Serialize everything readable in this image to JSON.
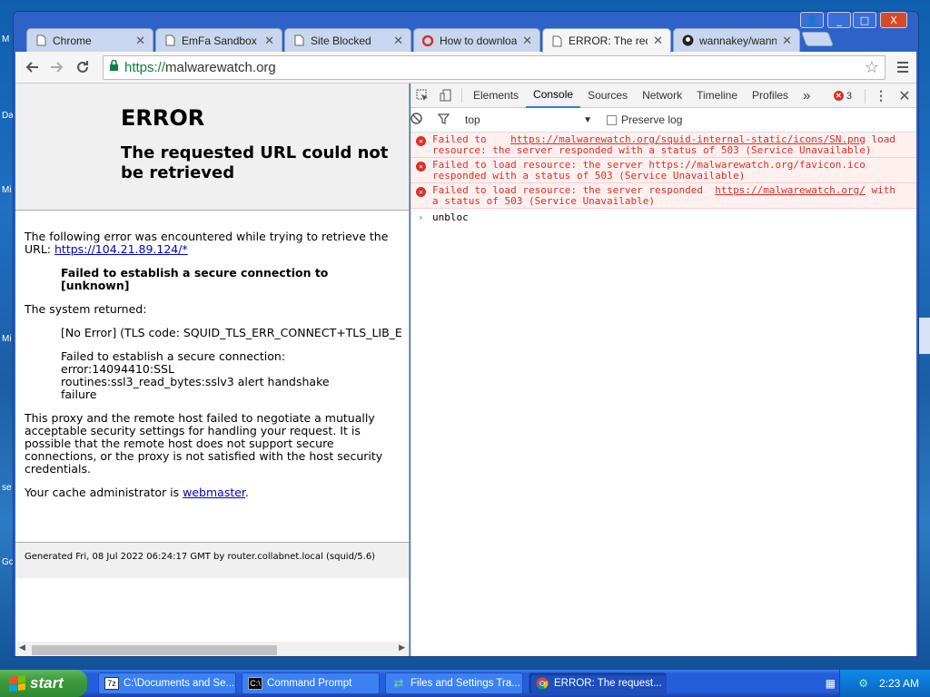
{
  "desktop": {
    "edge_labels": [
      "M",
      "Da",
      "Mi",
      "Mi",
      "se",
      "Gc"
    ]
  },
  "window": {
    "controls": {
      "help": "?",
      "minimize": "_",
      "maximize": "□",
      "close": "X"
    }
  },
  "tabs": [
    {
      "label": "Chrome",
      "icon": "page-icon",
      "active": false
    },
    {
      "label": "EmFa Sandbox",
      "icon": "page-icon",
      "active": false
    },
    {
      "label": "Site Blocked",
      "icon": "page-icon",
      "active": false
    },
    {
      "label": "How to download",
      "icon": "opera-icon",
      "active": false
    },
    {
      "label": "ERROR: The reque",
      "icon": "page-icon",
      "active": true
    },
    {
      "label": "wannakey/wanna",
      "icon": "github-icon",
      "active": false
    }
  ],
  "omnibox": {
    "scheme": "https://",
    "host": "malwarewatch.org"
  },
  "error_page": {
    "title": "ERROR",
    "subtitle": "The requested URL could not be retrieved",
    "intro": "The following error was encountered while trying to retrieve the URL:",
    "url": "https://104.21.89.124/*",
    "failure_line1": "Failed to establish a secure connection to",
    "failure_line2": "[unknown]",
    "system_returned": "The system returned:",
    "tls_code": "[No Error] (TLS code: SQUID_TLS_ERR_CONNECT+TLS_LIB_E",
    "detail_1": "Failed to establish a secure connection:",
    "detail_2": "error:14094410:SSL",
    "detail_3": "routines:ssl3_read_bytes:sslv3 alert handshake",
    "detail_4": "failure",
    "explanation": "This proxy and the remote host failed to negotiate a mutually acceptable security settings for handling your request. It is possible that the remote host does not support secure connections, or the proxy is not satisfied with the host security credentials.",
    "cache_admin_prefix": "Your cache administrator is",
    "cache_admin_link": "webmaster",
    "cache_admin_suffix": ".",
    "footer": "Generated Fri, 08 Jul 2022 06:24:17 GMT by router.collabnet.local (squid/5.6)"
  },
  "devtools": {
    "tabs": [
      "Elements",
      "Console",
      "Sources",
      "Network",
      "Timeline",
      "Profiles"
    ],
    "active_tab": "Console",
    "more": "»",
    "error_count": "3",
    "context": "top",
    "preserve_log": "Preserve log",
    "messages": [
      {
        "prefix": "Failed to",
        "link": "https://malwarewatch.org/squid-internal-static/icons/SN.png",
        "rest": "load resource: the server responded with a status of 503 (Service Unavailable)"
      },
      {
        "prefix": "Failed to load resource: the server",
        "link": "",
        "rest": "https://malwarewatch.org/favicon.ico responded with a status of 503 (Service Unavailable)"
      },
      {
        "prefix": "Failed to load resource: the server responded",
        "link": "https://malwarewatch.org/",
        "rest": "with a status of 503 (Service Unavailable)"
      }
    ],
    "prompt_text": "unbloc"
  },
  "taskbar": {
    "start_label": "start",
    "tasks": [
      {
        "label": "C:\\Documents and Se...",
        "icon": "explorer-icon",
        "active": false
      },
      {
        "label": "Command Prompt",
        "icon": "cmd-icon",
        "active": false
      },
      {
        "label": "Files and Settings Tra...",
        "icon": "transfer-icon",
        "active": false
      },
      {
        "label": "ERROR: The request...",
        "icon": "chrome-icon",
        "active": true
      }
    ],
    "clock": "2:23 AM"
  },
  "colors": {
    "error_red": "#d93025",
    "secure_green": "#0b8043",
    "link_blue": "#0000cc",
    "accent_blue": "#3879d9"
  }
}
